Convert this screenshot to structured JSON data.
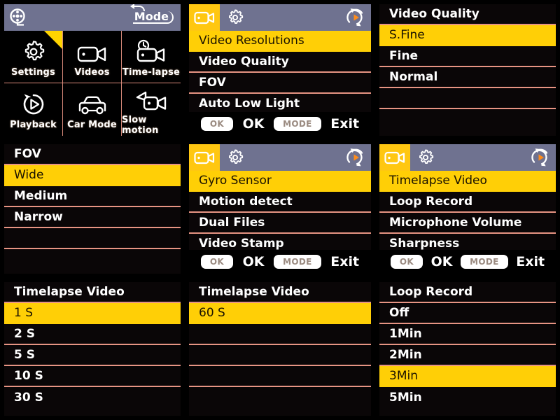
{
  "panels": {
    "main_menu": {
      "statusbar": {
        "left_icon": "film-reel-icon",
        "mode_label": "Mode"
      },
      "cells": [
        {
          "label": "Settings",
          "icon": "gear-icon",
          "selected": true
        },
        {
          "label": "Videos",
          "icon": "video-camera-icon",
          "selected": false
        },
        {
          "label": "Time-lapse",
          "icon": "timelapse-camera-icon",
          "selected": false
        },
        {
          "label": "Playback",
          "icon": "playback-icon",
          "selected": false
        },
        {
          "label": "Car Mode",
          "icon": "car-icon",
          "selected": false
        },
        {
          "label": "Slow motion",
          "icon": "slow-motion-icon",
          "selected": false
        }
      ]
    },
    "video_menu_1": {
      "tabs": [
        {
          "icon": "video-camera-icon",
          "active": true
        },
        {
          "icon": "gear-icon",
          "active": false
        }
      ],
      "right_icon": "loop-record-icon",
      "items": [
        {
          "label": "Video Resolutions",
          "selected": true
        },
        {
          "label": "Video Quality",
          "selected": false
        },
        {
          "label": "FOV",
          "selected": false
        },
        {
          "label": "Auto Low Light",
          "selected": false
        }
      ],
      "buttons": [
        {
          "type": "key",
          "label": "OK"
        },
        {
          "type": "text",
          "label": "OK"
        },
        {
          "type": "key",
          "label": "MODE"
        },
        {
          "type": "text",
          "label": "Exit"
        }
      ]
    },
    "video_quality": {
      "title": "Video Quality",
      "options": [
        {
          "label": "S.Fine",
          "selected": true
        },
        {
          "label": "Fine",
          "selected": false
        },
        {
          "label": "Normal",
          "selected": false
        },
        {
          "label": "",
          "selected": false
        },
        {
          "label": "",
          "selected": false
        }
      ]
    },
    "fov": {
      "title": "FOV",
      "options": [
        {
          "label": "Wide",
          "selected": true
        },
        {
          "label": "Medium",
          "selected": false
        },
        {
          "label": "Narrow",
          "selected": false
        },
        {
          "label": "",
          "selected": false
        },
        {
          "label": "",
          "selected": false
        }
      ]
    },
    "video_menu_2": {
      "tabs": [
        {
          "icon": "video-camera-icon",
          "active": true
        },
        {
          "icon": "gear-icon",
          "active": false
        }
      ],
      "right_icon": "loop-record-icon",
      "items": [
        {
          "label": "Gyro Sensor",
          "selected": true
        },
        {
          "label": "Motion detect",
          "selected": false
        },
        {
          "label": "Dual Files",
          "selected": false
        },
        {
          "label": "Video Stamp",
          "selected": false
        }
      ],
      "buttons": [
        {
          "type": "key",
          "label": "OK"
        },
        {
          "type": "text",
          "label": "OK"
        },
        {
          "type": "key",
          "label": "MODE"
        },
        {
          "type": "text",
          "label": "Exit"
        }
      ]
    },
    "video_menu_3": {
      "tabs": [
        {
          "icon": "video-camera-icon",
          "active": true
        },
        {
          "icon": "gear-icon",
          "active": false
        }
      ],
      "right_icon": "loop-record-icon",
      "items": [
        {
          "label": "Timelapse Video",
          "selected": true
        },
        {
          "label": "Loop Record",
          "selected": false
        },
        {
          "label": "Microphone Volume",
          "selected": false
        },
        {
          "label": "Sharpness",
          "selected": false
        }
      ],
      "buttons": [
        {
          "type": "key",
          "label": "OK"
        },
        {
          "type": "text",
          "label": "OK"
        },
        {
          "type": "key",
          "label": "MODE"
        },
        {
          "type": "text",
          "label": "Exit"
        }
      ]
    },
    "timelapse_page1": {
      "title": "Timelapse Video",
      "options": [
        {
          "label": "1 S",
          "selected": true
        },
        {
          "label": "2 S",
          "selected": false
        },
        {
          "label": "5 S",
          "selected": false
        },
        {
          "label": "10 S",
          "selected": false
        },
        {
          "label": "30 S",
          "selected": false
        }
      ]
    },
    "timelapse_page2": {
      "title": "Timelapse Video",
      "options": [
        {
          "label": "60 S",
          "selected": true
        },
        {
          "label": "",
          "selected": false
        },
        {
          "label": "",
          "selected": false
        },
        {
          "label": "",
          "selected": false
        },
        {
          "label": "",
          "selected": false
        }
      ]
    },
    "loop_record": {
      "title": "Loop Record",
      "options": [
        {
          "label": "Off",
          "selected": false
        },
        {
          "label": "1Min",
          "selected": false
        },
        {
          "label": "2Min",
          "selected": false
        },
        {
          "label": "3Min",
          "selected": true
        },
        {
          "label": "5Min",
          "selected": false
        }
      ]
    }
  },
  "colors": {
    "highlight_yellow": "#ffcf06",
    "separator_salmon": "#e79483",
    "statusbar_blue_gray": "#6f7290",
    "screen_black": "#0a0607",
    "text_white": "#ffffff",
    "play_orange": "#ff8c1a"
  }
}
